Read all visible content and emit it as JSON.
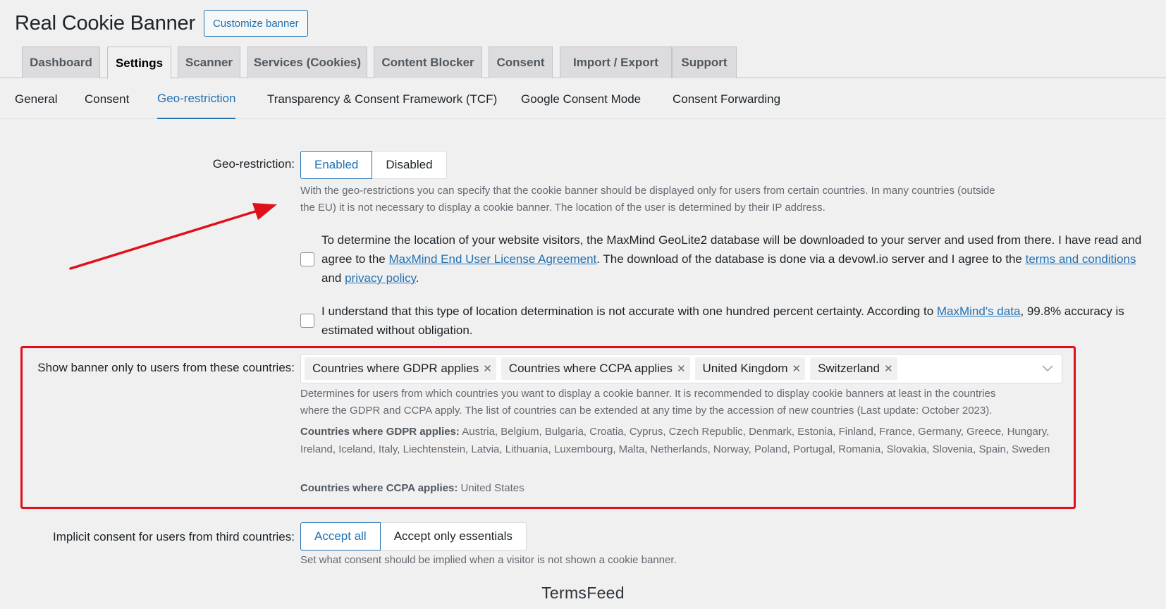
{
  "header": {
    "title": "Real Cookie Banner",
    "customize_label": "Customize banner"
  },
  "main_tabs": [
    {
      "label": "Dashboard",
      "active": false
    },
    {
      "label": "Settings",
      "active": true
    },
    {
      "label": "Scanner",
      "active": false
    },
    {
      "label": "Services (Cookies)",
      "active": false
    },
    {
      "label": "Content Blocker",
      "active": false
    },
    {
      "label": "Consent",
      "active": false
    },
    {
      "label": "Import / Export",
      "active": false
    },
    {
      "label": "Support",
      "active": false
    }
  ],
  "sub_nav": [
    {
      "label": "General",
      "active": false
    },
    {
      "label": "Consent",
      "active": false
    },
    {
      "label": "Geo-restriction",
      "active": true
    },
    {
      "label": "Transparency & Consent Framework (TCF)",
      "active": false
    },
    {
      "label": "Google Consent Mode",
      "active": false
    },
    {
      "label": "Consent Forwarding",
      "active": false
    }
  ],
  "geo": {
    "label": "Geo-restriction:",
    "options": [
      "Enabled",
      "Disabled"
    ],
    "selected": "Enabled",
    "description_1": "With the geo-restrictions you can specify that the cookie banner should be displayed only for users from certain countries. In many countries (outside",
    "description_2": "the EU) it is not necessary to display a cookie banner. The location of the user is determined by their IP address."
  },
  "check1": {
    "text_a": "To determine the location of your website visitors, the MaxMind GeoLite2 database will be downloaded to your server and used from there. I have read and agree to the ",
    "link_1": "MaxMind End User License Agreement",
    "text_b": ". The download of the database is done via a devowl.io server and I agree to the ",
    "link_2": "terms and conditions",
    "text_c": " and ",
    "link_3": "privacy policy",
    "text_d": "."
  },
  "check2": {
    "text_a": "I understand that this type of location determination is not accurate with one hundred percent certainty. According to ",
    "link_1": "MaxMind's data",
    "text_b": ", 99.8% accuracy is estimated without obligation."
  },
  "countries": {
    "label": "Show banner only to users from these countries:",
    "chips": [
      "Countries where GDPR applies",
      "Countries where CCPA applies",
      "United Kingdom",
      "Switzerland"
    ],
    "description_1": "Determines for users from which countries you want to display a cookie banner. It is recommended to display cookie banners at least in the countries",
    "description_2": "where the GDPR and CCPA apply. The list of countries can be extended at any time by the accession of new countries (Last update: October 2023).",
    "gdpr_title": "Countries where GDPR applies:",
    "gdpr_list": " Austria, Belgium, Bulgaria, Croatia, Cyprus, Czech Republic, Denmark, Estonia, Finland, France, Germany, Greece, Hungary, Ireland, Iceland, Italy, Liechtenstein, Latvia, Lithuania, Luxembourg, Malta, Netherlands, Norway, Poland, Portugal, Romania, Slovakia, Slovenia, Spain, Sweden",
    "ccpa_title": "Countries where CCPA applies:",
    "ccpa_list": " United States"
  },
  "implicit": {
    "label": "Implicit consent for users from third countries:",
    "options": [
      "Accept all",
      "Accept only essentials"
    ],
    "selected": "Accept all",
    "description": "Set what consent should be implied when a visitor is not shown a cookie banner."
  },
  "watermark": "TermsFeed",
  "colors": {
    "accent": "#2271b1",
    "highlight": "#e0101a",
    "background": "#f0f0f1"
  }
}
